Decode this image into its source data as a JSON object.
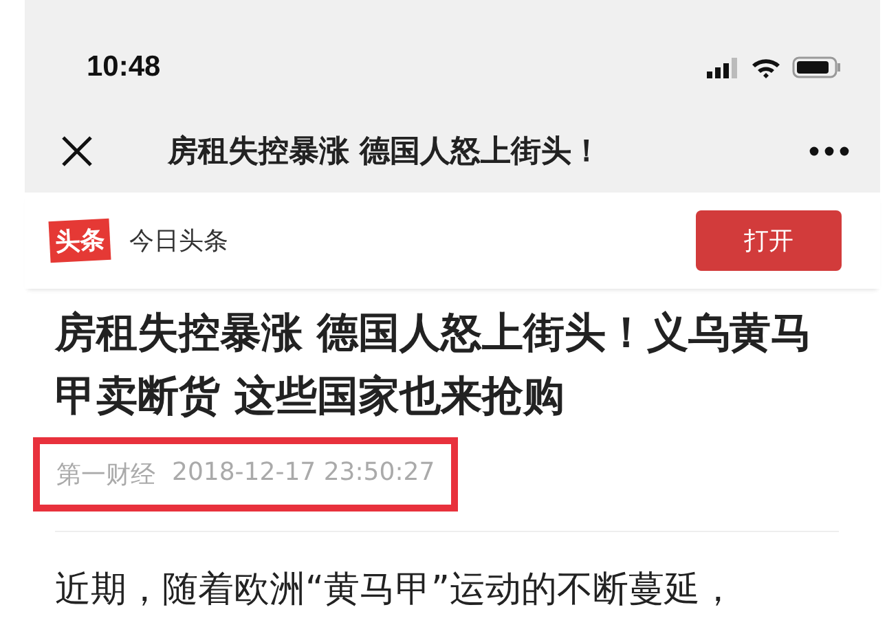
{
  "status_bar": {
    "time": "10:48"
  },
  "nav": {
    "title": "房租失控暴涨 德国人怒上街头！"
  },
  "banner": {
    "logo": "头条",
    "app_name": "今日头条",
    "open_button": "打开"
  },
  "article": {
    "headline": "房租失控暴涨 德国人怒上街头！义乌黄马甲卖断货 这些国家也来抢购",
    "meta": {
      "source": "第一财经",
      "datetime": "2018-12-17 23:50:27",
      "highlighted": true
    },
    "body": "近期，随着欧洲“黄马甲”运动的不断蔓延，"
  }
}
